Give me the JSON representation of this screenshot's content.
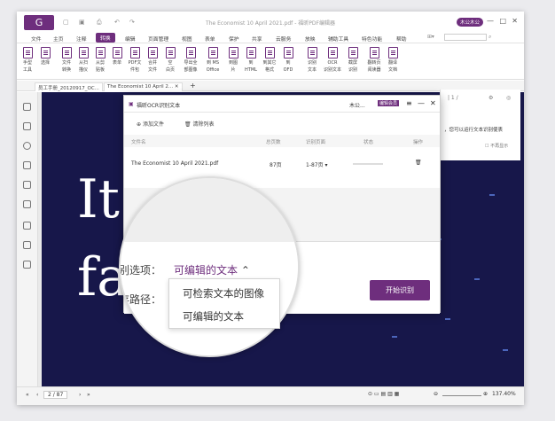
{
  "app": {
    "title": "The Economist 10 April 2021.pdf - 福昕PDF编辑器",
    "user": "木公木公",
    "logo": "G"
  },
  "menu": [
    "文件",
    "主页",
    "注释",
    "转换",
    "编辑",
    "页面管理",
    "视图",
    "表单",
    "保护",
    "共享",
    "云服务",
    "放映",
    "辅助工具",
    "特色功能",
    "帮助"
  ],
  "active_menu": "转换",
  "search_placeholder": "",
  "ribbon": [
    {
      "l1": "手型",
      "l2": "工具"
    },
    {
      "l1": "选择",
      "l2": ""
    },
    {
      "l1": "文件",
      "l2": "转换"
    },
    {
      "l1": "从扫",
      "l2": "描仪"
    },
    {
      "l1": "从剪",
      "l2": "贴板"
    },
    {
      "l1": "表单",
      "l2": ""
    },
    {
      "l1": "PDF文",
      "l2": "件包"
    },
    {
      "l1": "合并",
      "l2": "文件"
    },
    {
      "l1": "空",
      "l2": "白页"
    },
    {
      "l1": "导出全",
      "l2": "部图像"
    },
    {
      "l1": "到 MS",
      "l2": "Office"
    },
    {
      "l1": "到图",
      "l2": "片"
    },
    {
      "l1": "到",
      "l2": "HTML"
    },
    {
      "l1": "到其它",
      "l2": "格式"
    },
    {
      "l1": "到",
      "l2": "OFD"
    },
    {
      "l1": "识别",
      "l2": "文本"
    },
    {
      "l1": "OCR",
      "l2": "识别文本"
    },
    {
      "l1": "截屏",
      "l2": "识别"
    },
    {
      "l1": "翻转页",
      "l2": "阅读器"
    },
    {
      "l1": "翻译",
      "l2": "文档"
    }
  ],
  "tabs": [
    "员工手册_20120917_OC...",
    "The Economist 10 April 2..."
  ],
  "right_panel": {
    "text": "，您可以运行文本识别使表",
    "check": "不再显示"
  },
  "dialog": {
    "title": "福昕OCR识别文本",
    "user": "木公...",
    "badge": "编辑会员",
    "add_file": "添加文件",
    "clear_list": "清除列表",
    "headers": [
      "文件名",
      "总页数",
      "识别页面",
      "状态",
      "操作"
    ],
    "row": {
      "name": "The Economist 10 April 2021.pdf",
      "pages": "87页",
      "range": "1-87页"
    },
    "start": "开始识别"
  },
  "magnifier": {
    "mode_label": "别选项：",
    "mode_value": "可编辑的文本",
    "path_label": "存路径："
  },
  "dropdown": [
    "可检索文本的图像",
    "可编辑的文本"
  ],
  "status": {
    "page": "2 / 87",
    "zoom": "137.40%"
  },
  "page_bg_text": [
    "It",
    "fa"
  ]
}
